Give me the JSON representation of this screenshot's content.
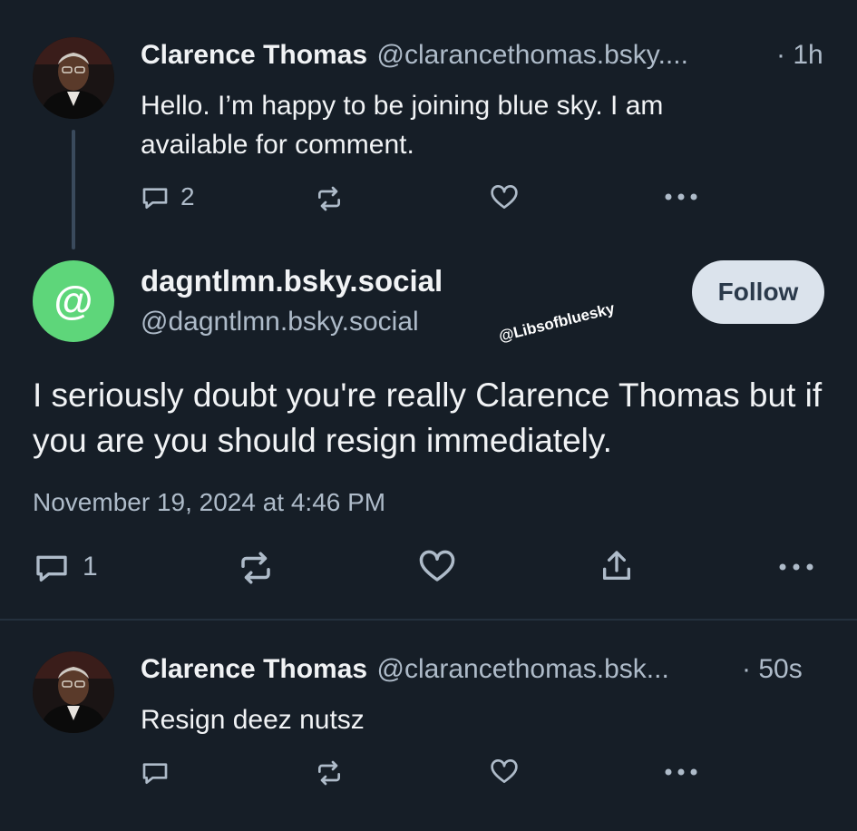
{
  "post1": {
    "author_name": "Clarence Thomas",
    "author_handle": "@clarancethomas.bsky....",
    "time": "· 1h",
    "text": "Hello. I’m happy to be joining blue sky. I am available for comment.",
    "reply_count": "2"
  },
  "post2": {
    "author_name": "dagntlmn.bsky.social",
    "author_handle": "@dagntlmn.bsky.social",
    "follow_label": "Follow",
    "text": "I seriously doubt you're really Clarence Thomas but if you are you should resign immediately.",
    "timestamp": "November 19, 2024 at 4:46 PM",
    "reply_count": "1",
    "avatar_symbol": "@"
  },
  "watermark": "@Libsofbluesky",
  "post3": {
    "author_name": "Clarence Thomas",
    "author_handle": "@clarancethomas.bsk...",
    "time": "· 50s",
    "text": "Resign deez nutsz"
  },
  "colors": {
    "background": "#161e27",
    "secondary_text": "#aebbc9",
    "avatar_green": "#5ed67a",
    "follow_bg": "#dbe3ec"
  }
}
